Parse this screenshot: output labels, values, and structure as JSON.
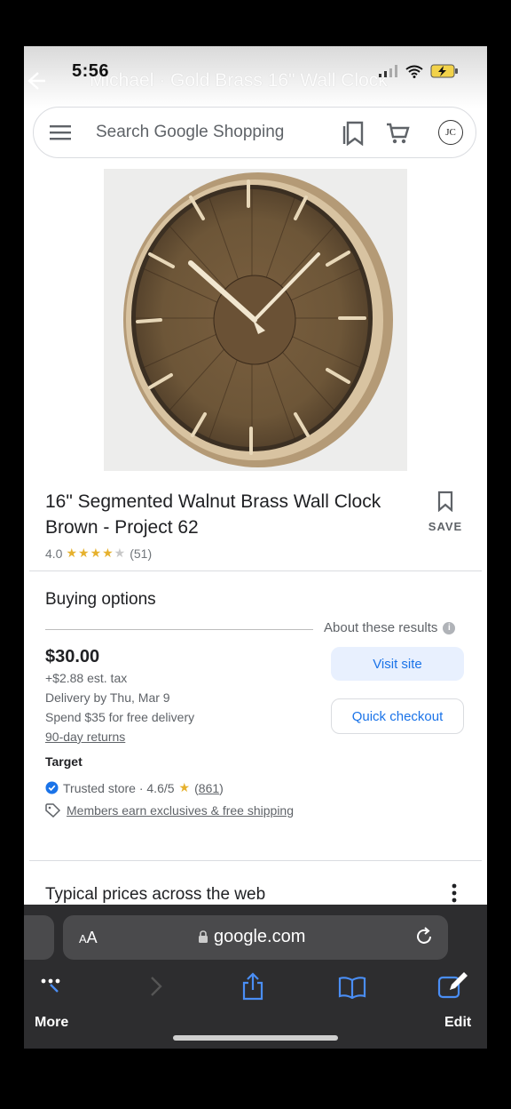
{
  "status": {
    "time": "5:56"
  },
  "page_title": "Michael · Gold Brass 16\" Wall Clock",
  "search": {
    "placeholder": "Search Google Shopping",
    "avatar_initials": "JC"
  },
  "product": {
    "title": "16\" Segmented Walnut Brass Wall Clock Brown - Project 62",
    "save_label": "SAVE",
    "rating_value": "4.0",
    "rating_stars": 4,
    "rating_max": 5,
    "review_count": "(51)"
  },
  "buying_options": {
    "heading": "Buying options",
    "about": "About these results",
    "price": "$30.00",
    "tax": "+$2.88 est. tax",
    "delivery": "Delivery by Thu, Mar 9",
    "free_delivery": "Spend $35 for free delivery",
    "returns": "90-day returns",
    "seller": "Target",
    "trusted_label": "Trusted store · 4.6/5",
    "trusted_count": "861",
    "members": "Members earn exclusives & free shipping",
    "visit_label": "Visit site",
    "quick_label": "Quick checkout"
  },
  "typical_prices": {
    "heading": "Typical prices across the web"
  },
  "browser": {
    "aa_label": "AA",
    "domain": "google.com",
    "more_label": "More",
    "edit_label": "Edit"
  },
  "colors": {
    "accent": "#1a73e8",
    "star": "#e6b12e",
    "visit_bg": "#e8f0fe",
    "safari_bar": "#2d2d2f"
  }
}
